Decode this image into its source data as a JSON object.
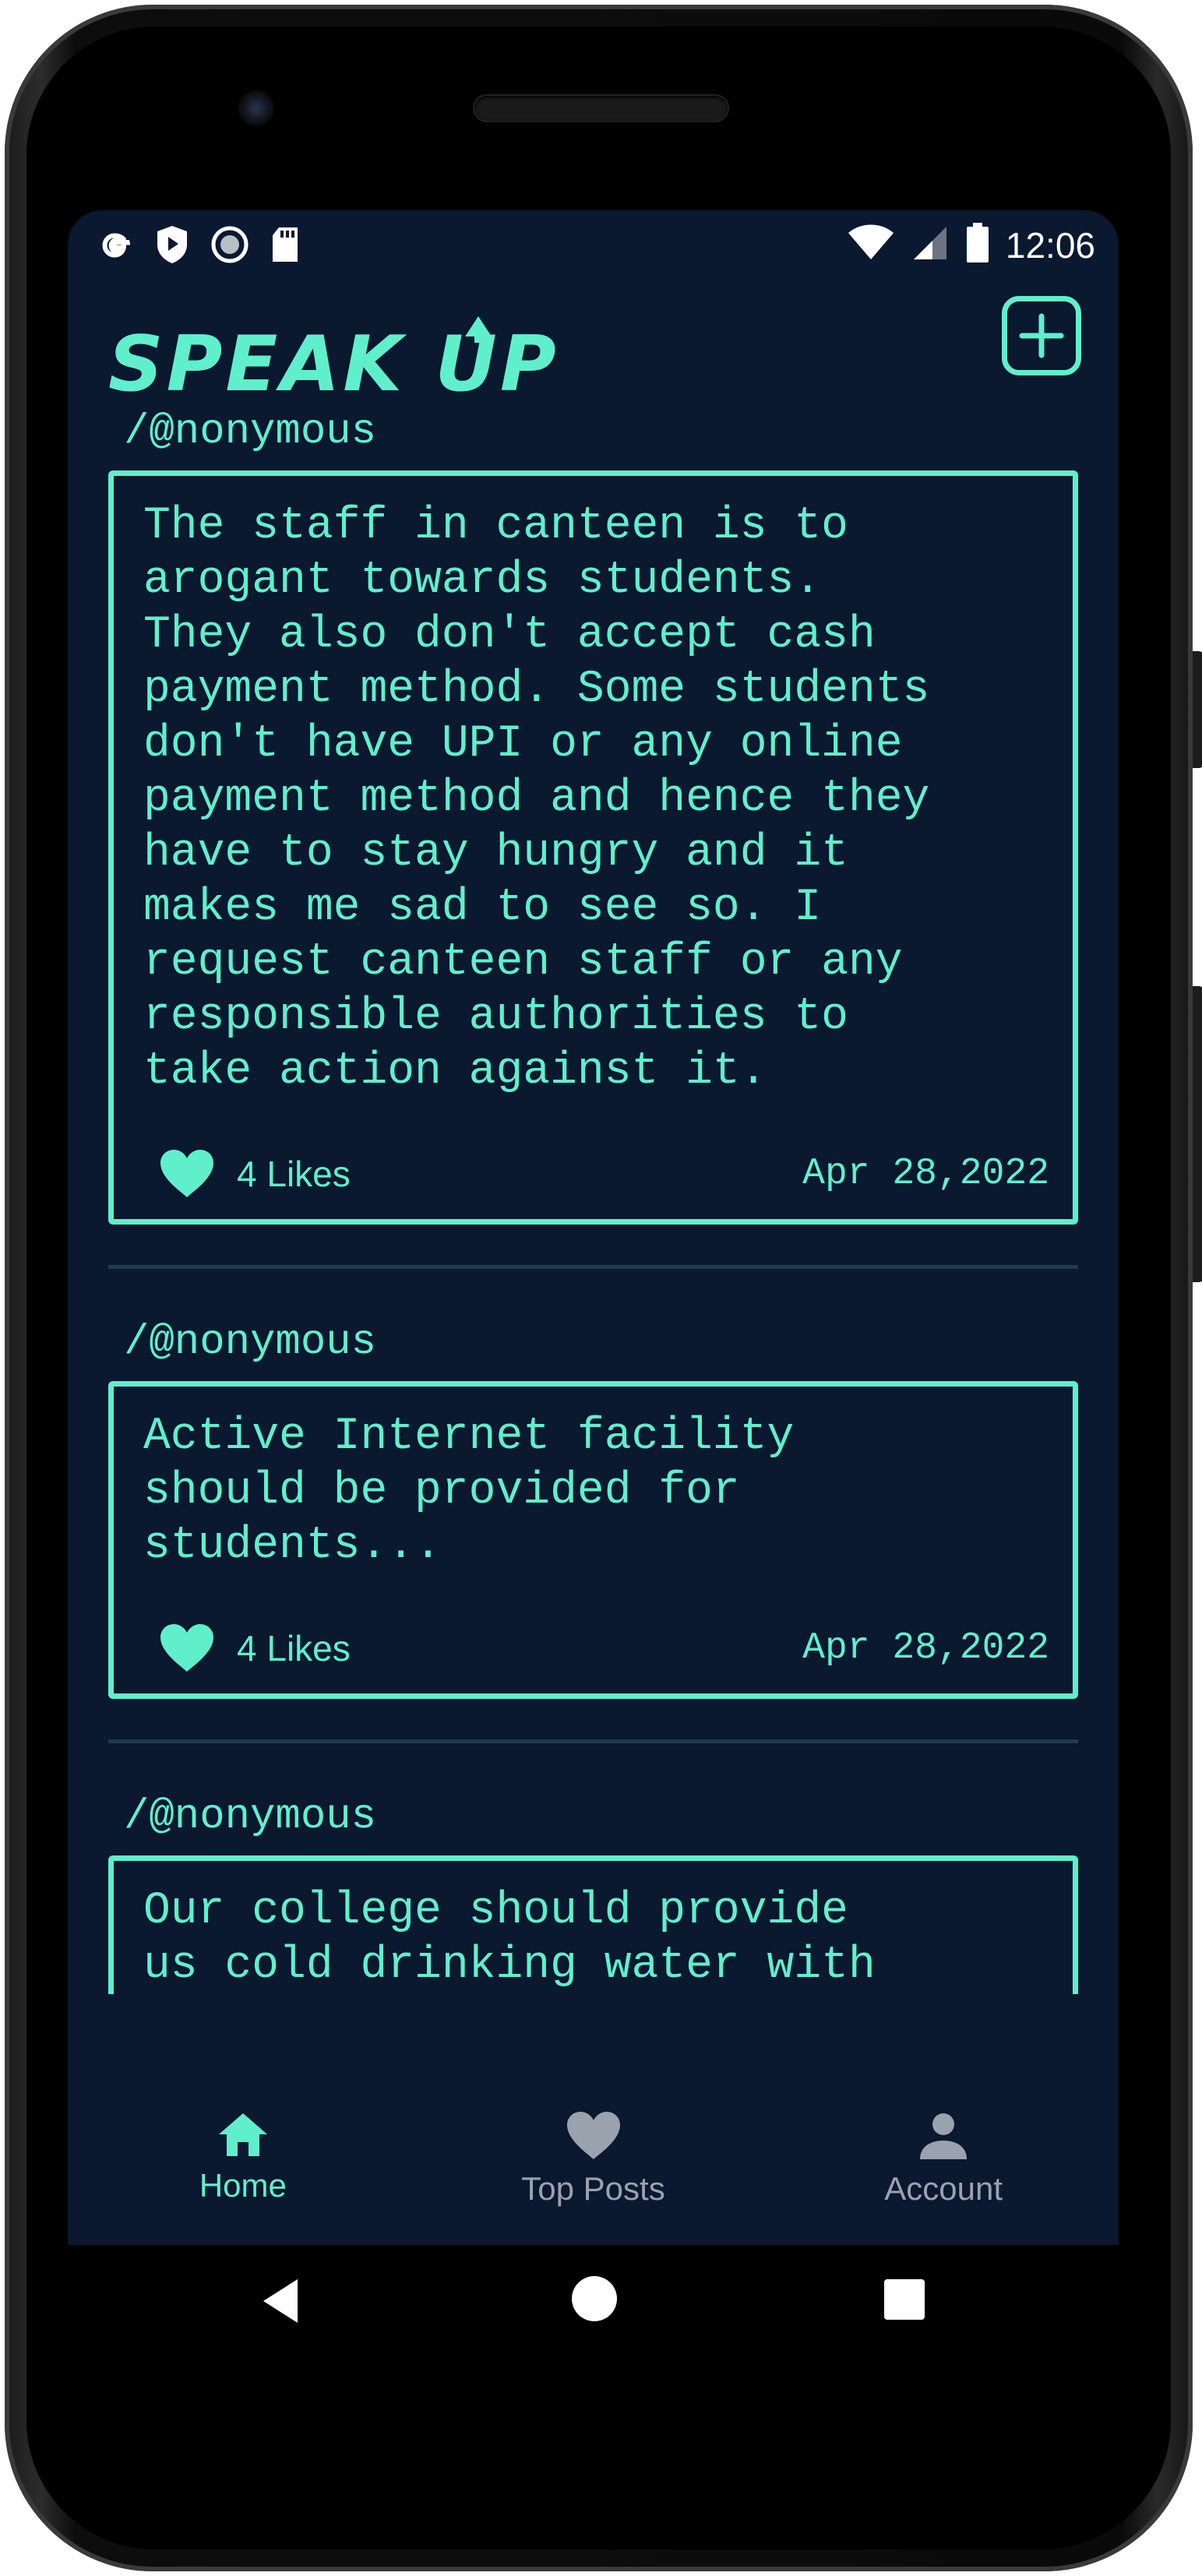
{
  "status_bar": {
    "left_icons": [
      "google-icon",
      "play-protect-icon",
      "record-icon",
      "sd-card-icon"
    ],
    "right_icons": [
      "wifi-icon",
      "signal-icon",
      "battery-icon"
    ],
    "time": "12:06"
  },
  "header": {
    "logo_text": "SPEAK UP",
    "add_button_icon": "plus-square-icon"
  },
  "posts": [
    {
      "author": "/@nonymous",
      "text": "The staff in canteen is to\narogant towards students.\nThey also don't accept cash\npayment method. Some students\ndon't have UPI or any online\npayment method and hence they\nhave to stay hungry and it\nmakes me sad to see so. I\nrequest canteen staff or any\nresponsible authorities to\ntake action against it.",
      "likes": "4 Likes",
      "date": "Apr 28,2022"
    },
    {
      "author": "/@nonymous",
      "text": "Active Internet facility\nshould be provided for\nstudents...",
      "likes": "4 Likes",
      "date": "Apr 28,2022"
    },
    {
      "author": "/@nonymous",
      "text": "Our college should provide\nus cold drinking water with\nrespect to passive summer...",
      "likes": "",
      "date": ""
    }
  ],
  "bottom_nav": {
    "items": [
      {
        "label": "Home",
        "icon": "home-icon",
        "active": true
      },
      {
        "label": "Top Posts",
        "icon": "heart-icon",
        "active": false
      },
      {
        "label": "Account",
        "icon": "person-icon",
        "active": false
      }
    ]
  },
  "system_nav": [
    "back-icon",
    "home-circle-icon",
    "recents-icon"
  ],
  "colors": {
    "background": "#0a1830",
    "accent": "#5ff0cb",
    "inactive": "#9aa3ad",
    "divider": "#1d3d4a"
  }
}
